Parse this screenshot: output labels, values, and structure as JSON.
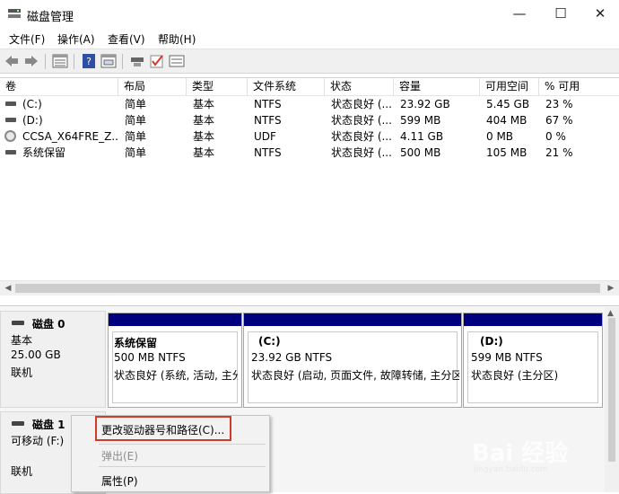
{
  "window": {
    "title": "磁盘管理",
    "minimize": "—",
    "maximize": "☐",
    "close": "✕"
  },
  "menu": [
    "文件(F)",
    "操作(A)",
    "查看(V)",
    "帮助(H)"
  ],
  "toolbar": {
    "icons": [
      "back-icon",
      "forward-icon",
      "list-view-icon",
      "help-icon",
      "properties-icon",
      "connect-icon",
      "check-icon",
      "settings-icon"
    ]
  },
  "table": {
    "columns": [
      "卷",
      "布局",
      "类型",
      "文件系统",
      "状态",
      "容量",
      "可用空间",
      "% 可用"
    ],
    "rows": [
      {
        "name": "(C:)",
        "layout": "简单",
        "type": "基本",
        "fs": "NTFS",
        "status": "状态良好 (...",
        "capacity": "23.92 GB",
        "free": "5.45 GB",
        "pct": "23 %",
        "icon": "drive-icon"
      },
      {
        "name": "(D:)",
        "layout": "简单",
        "type": "基本",
        "fs": "NTFS",
        "status": "状态良好 (...",
        "capacity": "599 MB",
        "free": "404 MB",
        "pct": "67 %",
        "icon": "drive-icon"
      },
      {
        "name": "CCSA_X64FRE_Z...",
        "layout": "简单",
        "type": "基本",
        "fs": "UDF",
        "status": "状态良好 (...",
        "capacity": "4.11 GB",
        "free": "0 MB",
        "pct": "0 %",
        "icon": "cd-icon"
      },
      {
        "name": "系统保留",
        "layout": "简单",
        "type": "基本",
        "fs": "NTFS",
        "status": "状态良好 (...",
        "capacity": "500 MB",
        "free": "105 MB",
        "pct": "21 %",
        "icon": "drive-icon"
      }
    ]
  },
  "disks": {
    "disk0": {
      "title": "磁盘 0",
      "type": "基本",
      "size": "25.00 GB",
      "status": "联机",
      "partitions": [
        {
          "name": "系统保留",
          "size": "500 MB NTFS",
          "status": "状态良好 (系统, 活动, 主分"
        },
        {
          "name": "(C:)",
          "size": "23.92 GB NTFS",
          "status": "状态良好 (启动, 页面文件, 故障转储, 主分区"
        },
        {
          "name": "(D:)",
          "size": "599 MB NTFS",
          "status": "状态良好 (主分区)"
        }
      ]
    },
    "disk1": {
      "title": "磁盘 1",
      "type": "可移动 (F:)",
      "status": "联机"
    }
  },
  "context_menu": {
    "items": [
      {
        "label": "更改驱动器号和路径(C)...",
        "enabled": true
      },
      {
        "label": "弹出(E)",
        "enabled": false
      },
      {
        "label": "属性(P)",
        "enabled": true
      }
    ]
  },
  "watermark": {
    "brand": "Bai  经验",
    "sub": "jingyan.baidu.com"
  },
  "colors": {
    "partition_bar": "#00007f",
    "highlight_box": "#d23a2c"
  }
}
